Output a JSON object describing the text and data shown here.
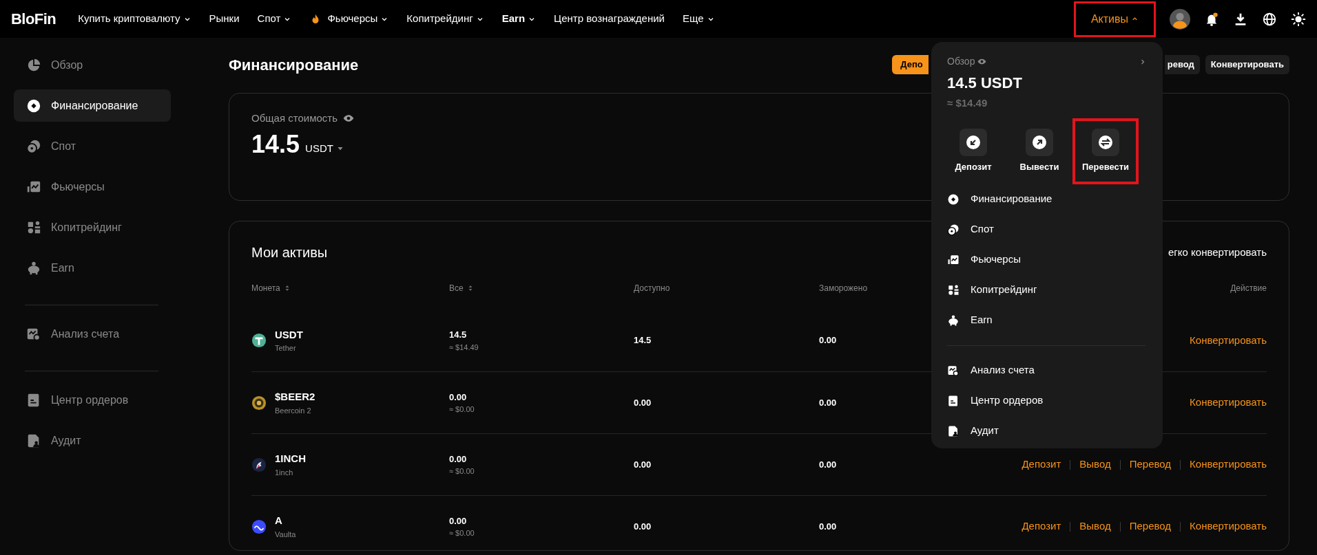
{
  "top_nav": {
    "logo": "BloFin",
    "items": [
      {
        "label": "Купить криптовалюту",
        "dropdown": true,
        "kind": "plain"
      },
      {
        "label": "Рынки",
        "dropdown": false,
        "kind": "plain"
      },
      {
        "label": "Спот",
        "dropdown": true,
        "kind": "plain"
      },
      {
        "label": "Фьючерсы",
        "dropdown": true,
        "kind": "fire"
      },
      {
        "label": "Копитрейдинг",
        "dropdown": true,
        "kind": "plain"
      },
      {
        "label": "Earn",
        "dropdown": true,
        "kind": "bold"
      },
      {
        "label": "Центр вознаграждений",
        "dropdown": false,
        "kind": "plain"
      },
      {
        "label": "Еще",
        "dropdown": true,
        "kind": "plain"
      }
    ],
    "assets_button": {
      "label": "Активы",
      "expanded": true,
      "highlighted": true
    }
  },
  "sidebar": {
    "groups": [
      [
        {
          "label": "Обзор",
          "selected": false
        },
        {
          "label": "Финансирование",
          "selected": true
        },
        {
          "label": "Спот",
          "selected": false
        },
        {
          "label": "Фьючерсы",
          "selected": false
        },
        {
          "label": "Копитрейдинг",
          "selected": false
        },
        {
          "label": "Earn",
          "selected": false
        }
      ],
      [
        {
          "label": "Анализ счета",
          "selected": false
        }
      ],
      [
        {
          "label": "Центр ордеров",
          "selected": false
        },
        {
          "label": "Аудит",
          "selected": false
        }
      ]
    ]
  },
  "page": {
    "title": "Финансирование",
    "header_buttons": [
      {
        "label": "Депо",
        "kind": "primary"
      },
      {
        "label": "ревод",
        "kind": "secondary"
      },
      {
        "label": "Конвертировать",
        "kind": "secondary"
      }
    ],
    "total": {
      "label": "Общая стоимость",
      "value": "14.5",
      "unit": "USDT"
    },
    "assets": {
      "title": "Мои активы",
      "convert_link": "егко конвертировать",
      "columns": [
        {
          "label": "Монета",
          "sortable": true
        },
        {
          "label": "Все",
          "sortable": true
        },
        {
          "label": "Доступно",
          "sortable": false
        },
        {
          "label": "Заморожено",
          "sortable": false
        },
        {
          "label": "Действие",
          "sortable": false
        }
      ],
      "rows": [
        {
          "symbol": "USDT",
          "name": "Tether",
          "total": "14.5",
          "total_usd": "≈ $14.49",
          "available": "14.5",
          "frozen": "0.00",
          "actions": [
            "Конвертировать"
          ]
        },
        {
          "symbol": "$BEER2",
          "name": "Beercoin 2",
          "total": "0.00",
          "total_usd": "≈ $0.00",
          "available": "0.00",
          "frozen": "0.00",
          "actions": [
            "Конвертировать"
          ]
        },
        {
          "symbol": "1INCH",
          "name": "1inch",
          "total": "0.00",
          "total_usd": "≈ $0.00",
          "available": "0.00",
          "frozen": "0.00",
          "actions": [
            "Депозит",
            "Вывод",
            "Перевод",
            "Конвертировать"
          ]
        },
        {
          "symbol": "A",
          "name": "Vaulta",
          "total": "0.00",
          "total_usd": "≈ $0.00",
          "available": "0.00",
          "frozen": "0.00",
          "actions": [
            "Депозит",
            "Вывод",
            "Перевод",
            "Конвертировать"
          ]
        }
      ]
    }
  },
  "assets_menu": {
    "overview_label": "Обзор",
    "amount": "14.5 USDT",
    "amount_usd": "≈ $14.49",
    "actions": [
      {
        "label": "Депозит",
        "highlighted": false
      },
      {
        "label": "Вывести",
        "highlighted": false
      },
      {
        "label": "Перевести",
        "highlighted": true
      }
    ],
    "groups": [
      [
        {
          "label": "Финансирование"
        },
        {
          "label": "Спот"
        },
        {
          "label": "Фьючерсы"
        },
        {
          "label": "Копитрейдинг"
        },
        {
          "label": "Earn"
        }
      ],
      [
        {
          "label": "Анализ счета"
        },
        {
          "label": "Центр ордеров"
        },
        {
          "label": "Аудит"
        }
      ]
    ]
  }
}
